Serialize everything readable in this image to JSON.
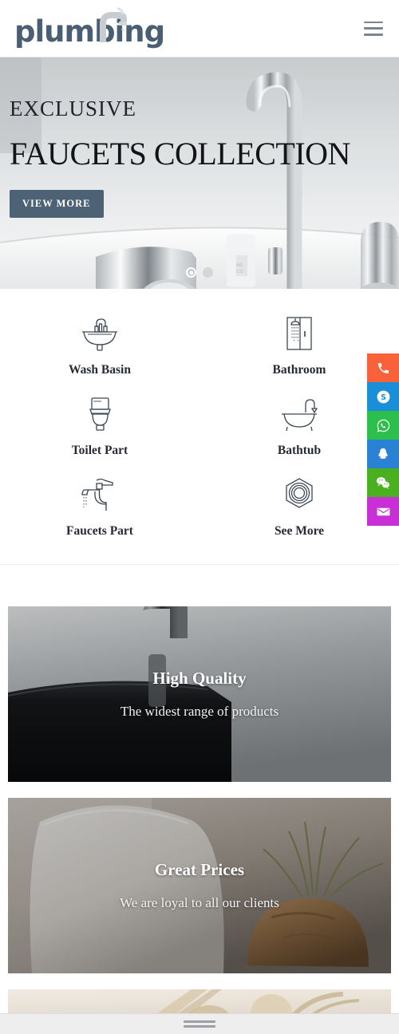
{
  "header": {
    "logo_text": "plumbing",
    "logo_icon": "faucet-icon",
    "menu_icon": "hamburger-menu-icon"
  },
  "hero": {
    "kicker": "EXCLUSIVE",
    "title": "FAUCETS COLLECTION",
    "button_label": "VIEW MORE",
    "button_color": "#4d6375",
    "dots": [
      {
        "active": true
      },
      {
        "active": false
      }
    ]
  },
  "categories": [
    {
      "label": "Wash Basin",
      "icon": "wash-basin-icon"
    },
    {
      "label": "Bathroom",
      "icon": "shower-cabin-icon"
    },
    {
      "label": "Toilet Part",
      "icon": "toilet-icon"
    },
    {
      "label": "Bathtub",
      "icon": "bathtub-icon"
    },
    {
      "label": "Faucets Part",
      "icon": "tap-valve-icon"
    },
    {
      "label": "See More",
      "icon": "hex-nut-icon"
    }
  ],
  "banners": [
    {
      "title": "High Quality",
      "subtitle": "The widest range of products"
    },
    {
      "title": "Great Prices",
      "subtitle": "We are loyal to all our clients"
    }
  ],
  "social": [
    {
      "name": "phone",
      "icon": "phone-icon",
      "color": "#f8613a"
    },
    {
      "name": "skype",
      "icon": "skype-icon",
      "color": "#1a8fd8"
    },
    {
      "name": "whatsapp",
      "icon": "whatsapp-icon",
      "color": "#2cbf4b"
    },
    {
      "name": "qq",
      "icon": "qq-icon",
      "color": "#2b82d4"
    },
    {
      "name": "wechat",
      "icon": "wechat-icon",
      "color": "#4bb01f"
    },
    {
      "name": "email",
      "icon": "email-icon",
      "color": "#c82fd6"
    }
  ],
  "bottom_bar": {
    "handle": "drag-handle"
  }
}
